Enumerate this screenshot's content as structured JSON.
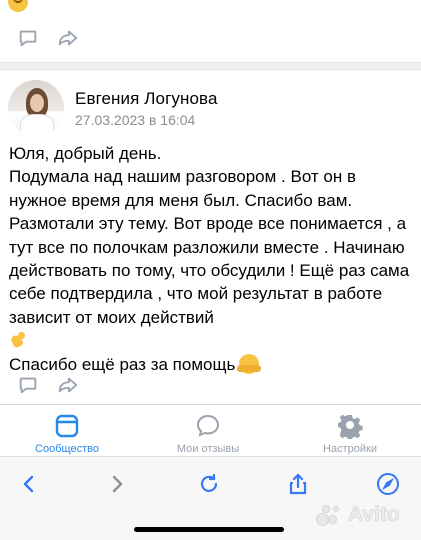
{
  "previous_post": {
    "reaction_icon": "smiling-face-icon"
  },
  "post": {
    "author": "Евгения Логунова",
    "date": "27.03.2023 в 16:04",
    "lines": [
      "Юля, добрый день.",
      "Подумала над нашим разговором . Вот он в нужное время для меня был. Спасибо вам. Размотали эту тему. Вот вроде все понимается , а тут все по полочкам разложили вместе . Начинаю действовать по тому, что обсудили ! Ещё раз сама себе подтвердила , что мой результат в работе зависит от моих действий",
      "Спасибо ещё раз за помощь"
    ],
    "emoji": [
      "flexed-biceps-emoji",
      "hugging-face-emoji"
    ]
  },
  "tabs": [
    {
      "label": "Сообщество",
      "icon": "community-icon",
      "active": true
    },
    {
      "label": "Мои отзывы",
      "icon": "reviews-icon",
      "active": false
    },
    {
      "label": "Настройки",
      "icon": "settings-icon",
      "active": false
    }
  ],
  "browser": {
    "icons": [
      "back-icon",
      "forward-icon",
      "reload-icon",
      "share-icon",
      "compass-icon"
    ]
  },
  "watermark": {
    "text": "Avito"
  },
  "colors": {
    "accent": "#2688eb",
    "icon_gray": "#99a2ad",
    "secondary_text": "#8a8d92"
  }
}
